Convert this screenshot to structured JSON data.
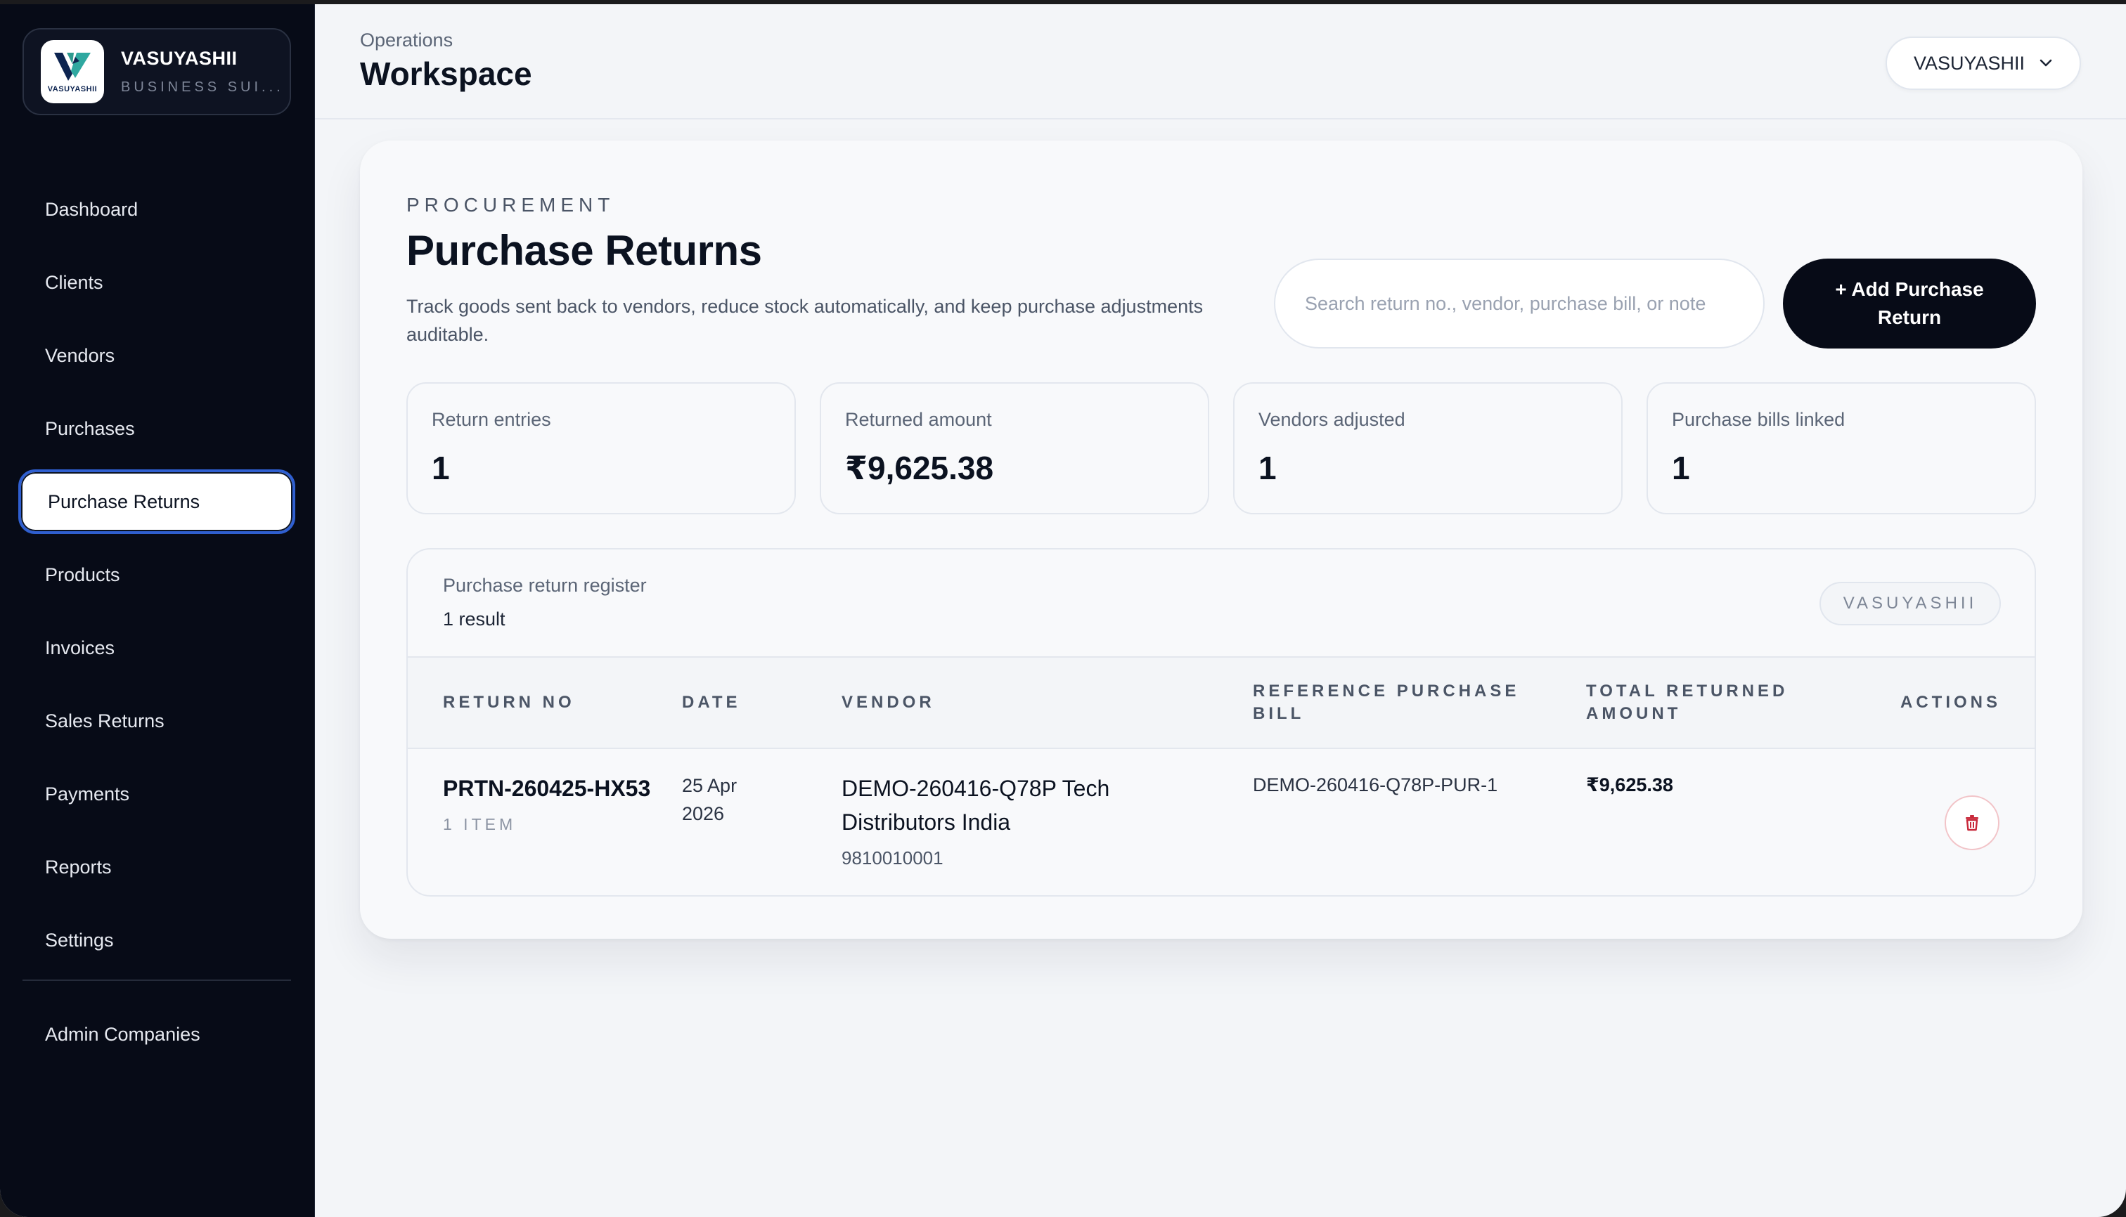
{
  "brand": {
    "name": "VASUYASHII",
    "subtitle": "BUSINESS SUI...",
    "logo_word": "VASUYASHII"
  },
  "sidebar": {
    "items": [
      {
        "label": "Dashboard"
      },
      {
        "label": "Clients"
      },
      {
        "label": "Vendors"
      },
      {
        "label": "Purchases"
      },
      {
        "label": "Purchase Returns",
        "active": true
      },
      {
        "label": "Products"
      },
      {
        "label": "Invoices"
      },
      {
        "label": "Sales Returns"
      },
      {
        "label": "Payments"
      },
      {
        "label": "Reports"
      },
      {
        "label": "Settings"
      }
    ],
    "admin": "Admin Companies"
  },
  "header": {
    "crumb": "Operations",
    "title": "Workspace",
    "company": "VASUYASHII"
  },
  "page": {
    "eyebrow": "PROCUREMENT",
    "title": "Purchase Returns",
    "description": "Track goods sent back to vendors, reduce stock automatically, and keep purchase adjustments auditable.",
    "search_placeholder": "Search return no., vendor, purchase bill, or note",
    "add_button": "+ Add Purchase Return"
  },
  "stats": [
    {
      "label": "Return entries",
      "value": "1"
    },
    {
      "label": "Returned amount",
      "value": "₹9,625.38"
    },
    {
      "label": "Vendors adjusted",
      "value": "1"
    },
    {
      "label": "Purchase bills linked",
      "value": "1"
    }
  ],
  "register": {
    "title": "Purchase return register",
    "count": "1 result",
    "badge": "VASUYASHII",
    "columns": [
      "RETURN NO",
      "DATE",
      "VENDOR",
      "REFERENCE PURCHASE BILL",
      "TOTAL RETURNED AMOUNT",
      "ACTIONS"
    ],
    "rows": [
      {
        "return_no": "PRTN-260425-HX53",
        "items": "1 ITEM",
        "date": "25 Apr 2026",
        "vendor": "DEMO-260416-Q78P Tech Distributors India",
        "vendor_phone": "9810010001",
        "reference": "DEMO-260416-Q78P-PUR-1",
        "amount": "₹9,625.38"
      }
    ]
  },
  "colors": {
    "sidebar_bg": "#070b17",
    "accent": "#2f5fd0",
    "primary_button": "#070b17",
    "danger": "#c8283a"
  }
}
